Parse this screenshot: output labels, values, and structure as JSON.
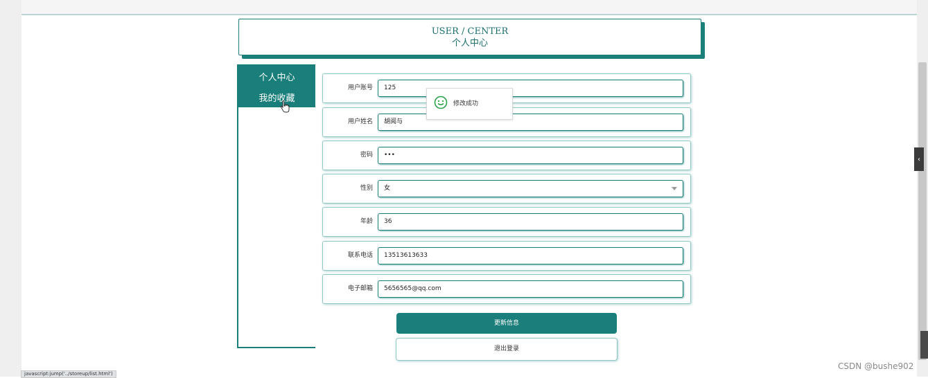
{
  "header": {
    "title_en": "USER / CENTER",
    "title_cn": "个人中心"
  },
  "sidebar": {
    "items": [
      {
        "label": "个人中心"
      },
      {
        "label": "我的收藏"
      }
    ]
  },
  "form": {
    "fields": [
      {
        "label": "用户账号",
        "value": "125"
      },
      {
        "label": "用户姓名",
        "value": "胡阅与"
      },
      {
        "label": "密码",
        "value": "•••"
      },
      {
        "label": "性别",
        "value": "女"
      },
      {
        "label": "年龄",
        "value": "36"
      },
      {
        "label": "联系电话",
        "value": "13513613633"
      },
      {
        "label": "电子邮箱",
        "value": "5656565@qq.com"
      }
    ]
  },
  "toast": {
    "message": "修改成功",
    "icon": "smile-icon"
  },
  "actions": {
    "update_label": "更新信息",
    "logout_label": "退出登录"
  },
  "status_bar": {
    "url": "javascript:jump('../storeup/list.html')"
  },
  "watermark": "CSDN @bushe902",
  "colors": {
    "accent": "#1a7f7a",
    "border_light": "#8fc9c5"
  }
}
